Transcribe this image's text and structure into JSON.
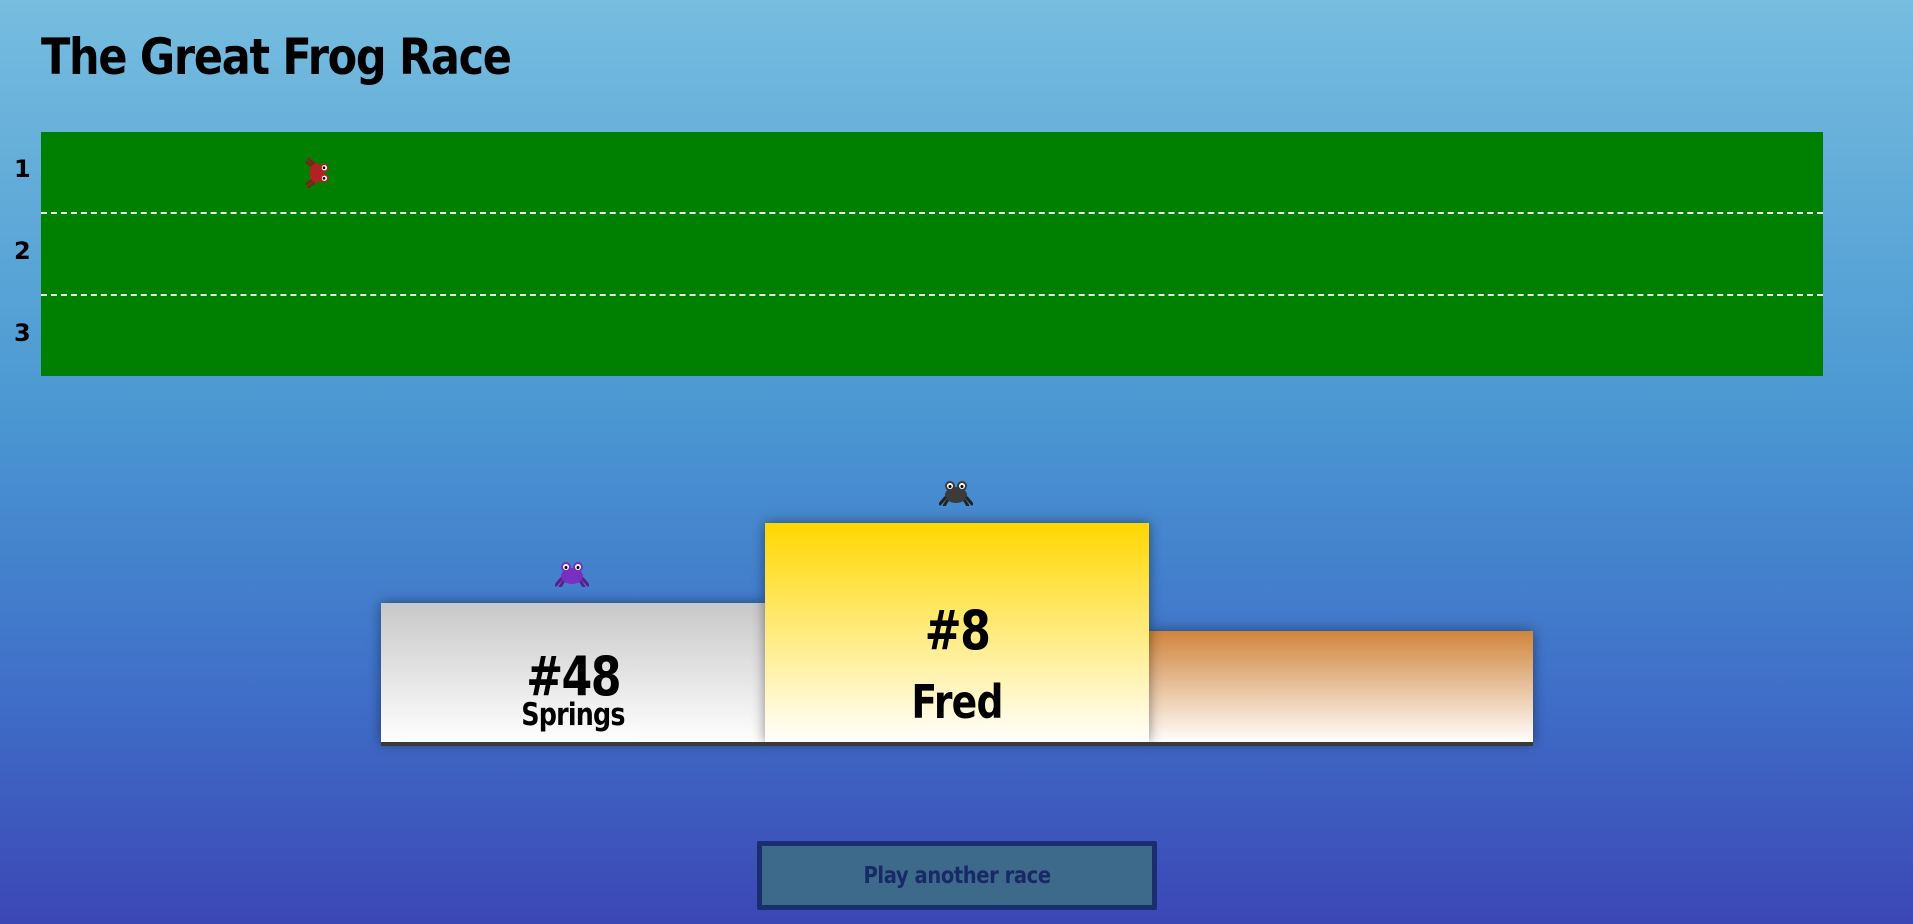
{
  "title": "The Great Frog Race",
  "lanes": [
    {
      "number": "1"
    },
    {
      "number": "2"
    },
    {
      "number": "3"
    }
  ],
  "racing_frog": {
    "icon": "frog-icon",
    "color": "#b22222",
    "lane": 1
  },
  "podium": {
    "first": {
      "number": "#8",
      "name": "Fred",
      "frog_color": "#3b3b3b",
      "color": "#ffd700"
    },
    "second": {
      "number": "#48",
      "name": "Springs",
      "frog_color": "#7b2fbf",
      "color": "#c8c8c8"
    },
    "third": {
      "color": "#d0843c"
    }
  },
  "play_button_label": "Play another race"
}
